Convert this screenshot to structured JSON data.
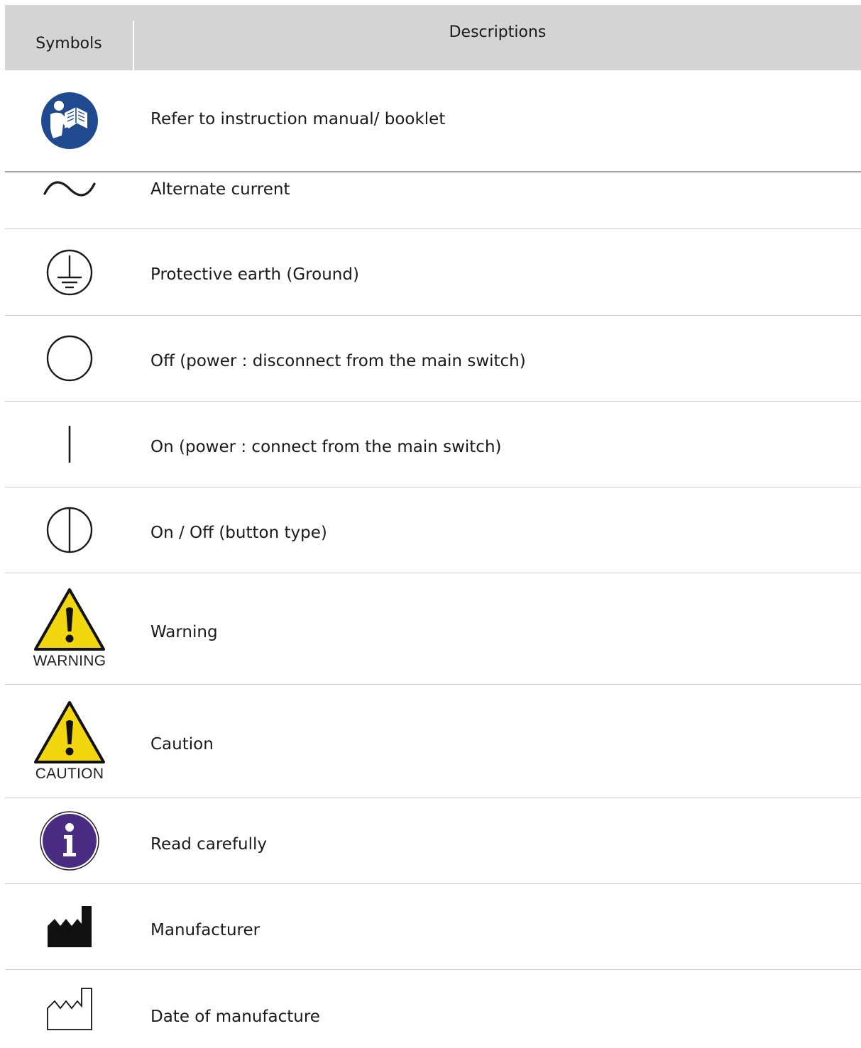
{
  "table": {
    "header": {
      "symbols": "Symbols",
      "descriptions": "Descriptions"
    },
    "rows": [
      {
        "icon": "instruction-manual-icon",
        "description": "Refer to instruction manual/ booklet"
      },
      {
        "icon": "alternating-current-icon",
        "description": "Alternate current"
      },
      {
        "icon": "protective-earth-icon",
        "description": "Protective earth (Ground)"
      },
      {
        "icon": "power-off-icon",
        "description": "Off (power : disconnect from the main switch)"
      },
      {
        "icon": "power-on-icon",
        "description": "On (power : connect from the main switch)"
      },
      {
        "icon": "power-on-off-button-icon",
        "description": "On / Off (button type)"
      },
      {
        "icon": "warning-triangle-icon",
        "caption": "WARNING",
        "description": "Warning"
      },
      {
        "icon": "caution-triangle-icon",
        "caption": "CAUTION",
        "description": "Caution"
      },
      {
        "icon": "info-icon",
        "description": "Read carefully"
      },
      {
        "icon": "manufacturer-icon",
        "description": "Manufacturer"
      },
      {
        "icon": "date-of-manufacture-icon",
        "description": "Date of manufacture"
      }
    ]
  },
  "colors": {
    "header_bg": "#d4d4d4",
    "manual_blue": "#1f4a8f",
    "warning_yellow": "#f2d70f",
    "info_purple": "#4a2c83"
  }
}
